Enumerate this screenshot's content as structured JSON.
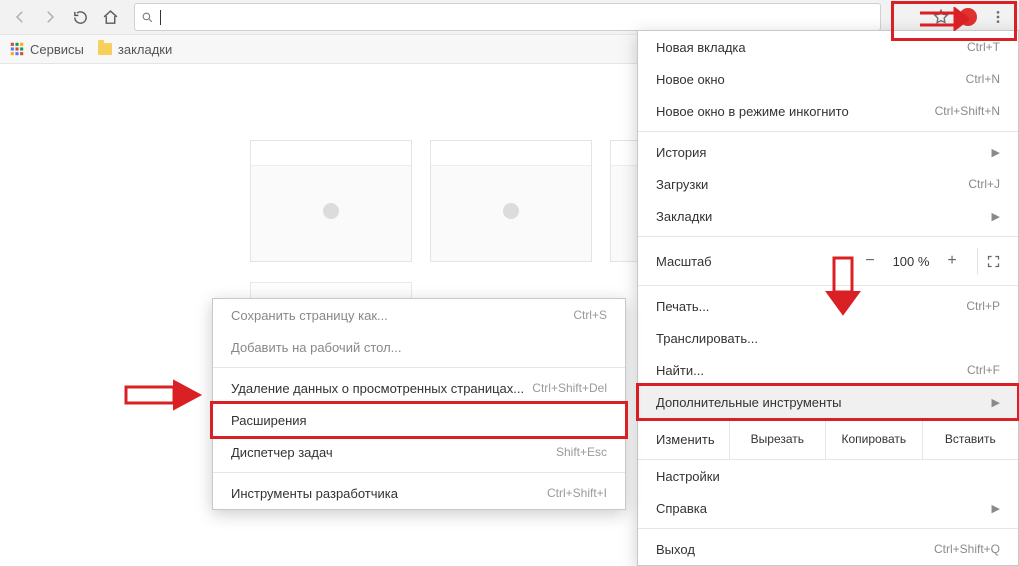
{
  "toolbar": {
    "url": ""
  },
  "bookmarks": {
    "apps": "Сервисы",
    "folder": "закладки"
  },
  "main_menu": {
    "new_tab": {
      "label": "Новая вкладка",
      "shortcut": "Ctrl+T"
    },
    "new_window": {
      "label": "Новое окно",
      "shortcut": "Ctrl+N"
    },
    "incognito": {
      "label": "Новое окно в режиме инкогнито",
      "shortcut": "Ctrl+Shift+N"
    },
    "history": {
      "label": "История"
    },
    "downloads": {
      "label": "Загрузки",
      "shortcut": "Ctrl+J"
    },
    "bookmarks": {
      "label": "Закладки"
    },
    "zoom_label": "Масштаб",
    "zoom_value": "100 %",
    "print": {
      "label": "Печать...",
      "shortcut": "Ctrl+P"
    },
    "cast": {
      "label": "Транслировать..."
    },
    "find": {
      "label": "Найти...",
      "shortcut": "Ctrl+F"
    },
    "more_tools": {
      "label": "Дополнительные инструменты"
    },
    "edit_label": "Изменить",
    "cut": "Вырезать",
    "copy": "Копировать",
    "paste": "Вставить",
    "settings": {
      "label": "Настройки"
    },
    "help": {
      "label": "Справка"
    },
    "exit": {
      "label": "Выход",
      "shortcut": "Ctrl+Shift+Q"
    }
  },
  "sub_menu": {
    "save_as": {
      "label": "Сохранить страницу как...",
      "shortcut": "Ctrl+S"
    },
    "add_to_desktop": {
      "label": "Добавить на рабочий стол..."
    },
    "clear_data": {
      "label": "Удаление данных о просмотренных страницах...",
      "shortcut": "Ctrl+Shift+Del"
    },
    "extensions": {
      "label": "Расширения"
    },
    "task_manager": {
      "label": "Диспетчер задач",
      "shortcut": "Shift+Esc"
    },
    "dev_tools": {
      "label": "Инструменты разработчика",
      "shortcut": "Ctrl+Shift+I"
    }
  }
}
